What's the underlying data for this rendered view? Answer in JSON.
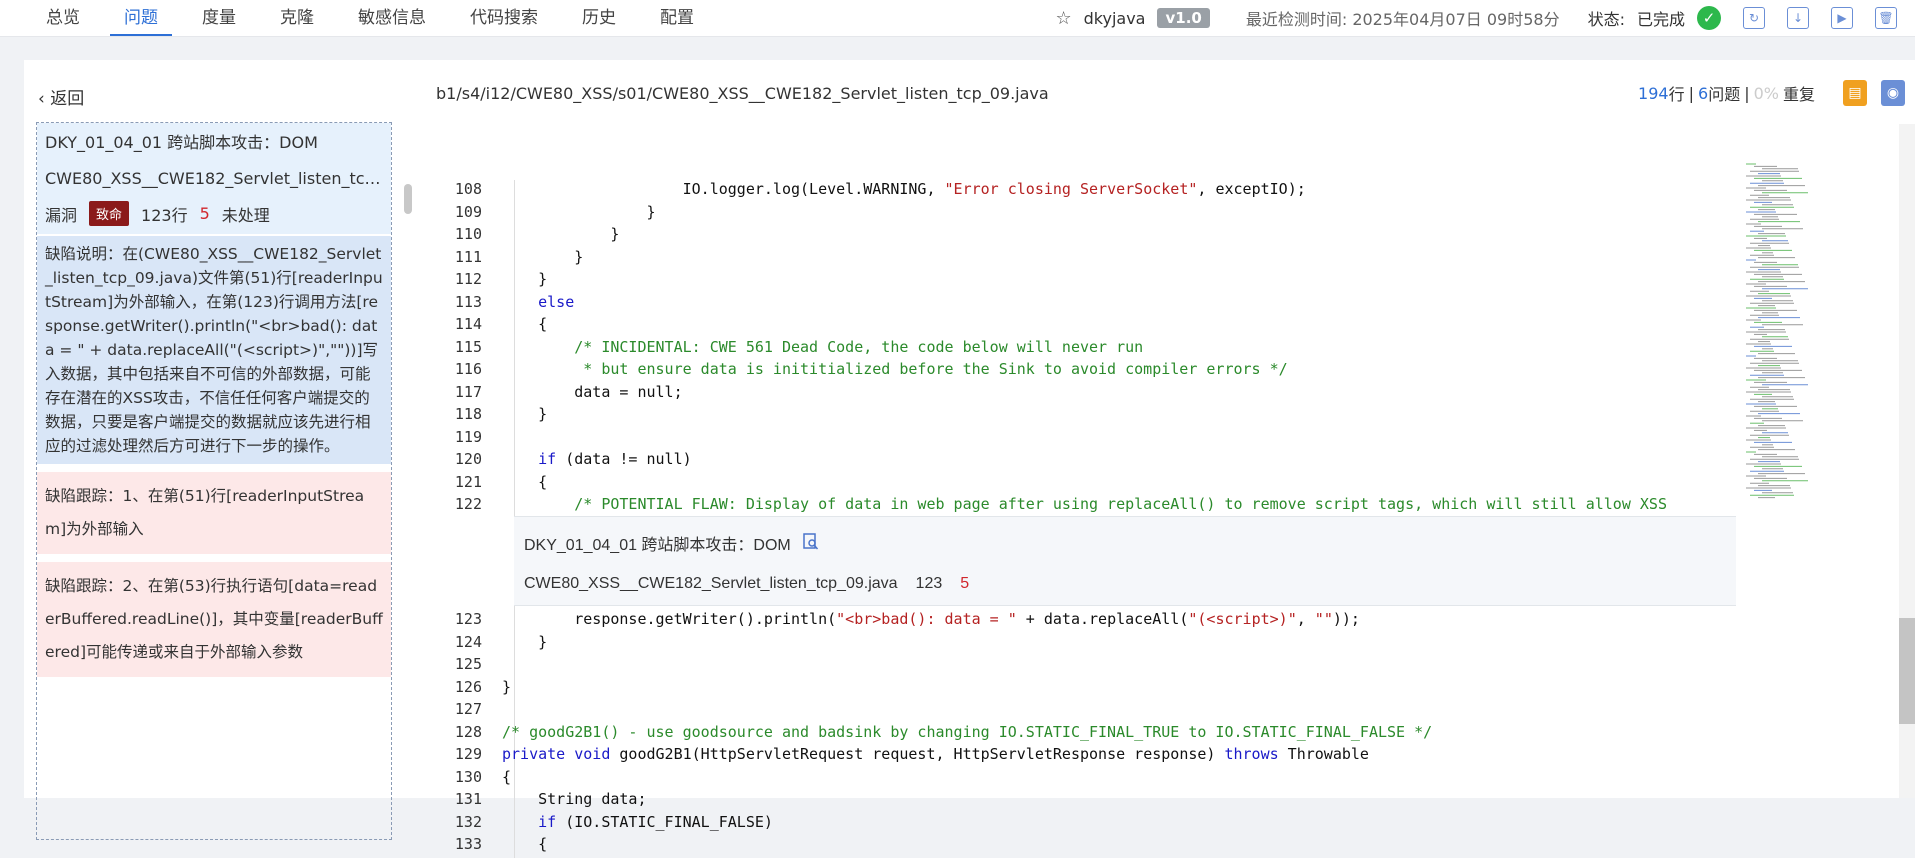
{
  "nav": {
    "tabs": [
      "总览",
      "问题",
      "度量",
      "克隆",
      "敏感信息",
      "代码搜索",
      "历史",
      "配置"
    ],
    "active": "问题"
  },
  "header": {
    "project": "dkyjava",
    "version": "v1.0",
    "last_check": "最近检测时间: 2025年04月07日 09时58分",
    "status_label": "状态:",
    "status_value": "已完成"
  },
  "left": {
    "back_label": "返回",
    "issue": {
      "title": "DKY_01_04_01 跨站脚本攻击：DOM",
      "file": "CWE80_XSS__CWE182_Servlet_listen_tcp_09.j...",
      "type": "漏洞",
      "severity": "致命",
      "lines": "123行",
      "count": "5",
      "state": "未处理",
      "description": "缺陷说明：在(CWE80_XSS__CWE182_Servlet_listen_tcp_09.java)文件第(51)行[readerInputStream]为外部输入，在第(123)行调用方法[response.getWriter().println(\"<br>bad(): data = \" + data.replaceAll(\"(<script>)\",\"\"))]写入数据，其中包括来自不可信的外部数据，可能存在潜在的XSS攻击，不信任任何客户端提交的数据，只要是客户端提交的数据就应该先进行相应的过滤处理然后方可进行下一步的操作。",
      "traces": [
        "缺陷跟踪：1、在第(51)行[readerInputStream]为外部输入",
        "缺陷跟踪：2、在第(53)行执行语句[data=readerBuffered.readLine()]，其中变量[readerBuffered]可能传递或来自于外部输入参数"
      ]
    }
  },
  "code": {
    "path": "b1/s4/i12/CWE80_XSS/s01/CWE80_XSS__CWE182_Servlet_listen_tcp_09.java",
    "line_count": "194",
    "line_count_unit": "行",
    "issue_count": "6",
    "issue_count_unit": "问题",
    "repeat_pct": "0%",
    "repeat_label": "重复",
    "lines_before": [
      {
        "n": "108",
        "t": "                    IO.logger.log(Level.WARNING, \"Error closing ServerSocket\", exceptIO);"
      },
      {
        "n": "109",
        "t": "                }"
      },
      {
        "n": "110",
        "t": "            }"
      },
      {
        "n": "111",
        "t": "        }"
      },
      {
        "n": "112",
        "t": "    }"
      },
      {
        "n": "113",
        "t": "    else"
      },
      {
        "n": "114",
        "t": "    {"
      },
      {
        "n": "115",
        "t": "        /* INCIDENTAL: CWE 561 Dead Code, the code below will never run"
      },
      {
        "n": "116",
        "t": "         * but ensure data is inititialized before the Sink to avoid compiler errors */"
      },
      {
        "n": "117",
        "t": "        data = null;"
      },
      {
        "n": "118",
        "t": "    }"
      },
      {
        "n": "119",
        "t": ""
      },
      {
        "n": "120",
        "t": "    if (data != null)"
      },
      {
        "n": "121",
        "t": "    {"
      },
      {
        "n": "122",
        "t": "        /* POTENTIAL FLAW: Display of data in web page after using replaceAll() to remove script tags, which will still allow XSS"
      }
    ],
    "popup": {
      "title": "DKY_01_04_01 跨站脚本攻击：DOM",
      "file": "CWE80_XSS__CWE182_Servlet_listen_tcp_09.java",
      "line": "123",
      "count": "5"
    },
    "lines_after": [
      {
        "n": "123",
        "t": "        response.getWriter().println(\"<br>bad(): data = \" + data.replaceAll(\"(<script>)\", \"\"));"
      },
      {
        "n": "124",
        "t": "    }"
      },
      {
        "n": "125",
        "t": ""
      },
      {
        "n": "126",
        "t": "}"
      },
      {
        "n": "127",
        "t": ""
      },
      {
        "n": "128",
        "t": "/* goodG2B1() - use goodsource and badsink by changing IO.STATIC_FINAL_TRUE to IO.STATIC_FINAL_FALSE */"
      },
      {
        "n": "129",
        "t": "private void goodG2B1(HttpServletRequest request, HttpServletResponse response) throws Throwable"
      },
      {
        "n": "130",
        "t": "{"
      },
      {
        "n": "131",
        "t": "    String data;"
      },
      {
        "n": "132",
        "t": "    if (IO.STATIC_FINAL_FALSE)"
      },
      {
        "n": "133",
        "t": "    {"
      }
    ]
  },
  "colors": {
    "accent": "#2d6fd6",
    "fatal": "#8b1a1a",
    "ok": "#2db84c"
  }
}
